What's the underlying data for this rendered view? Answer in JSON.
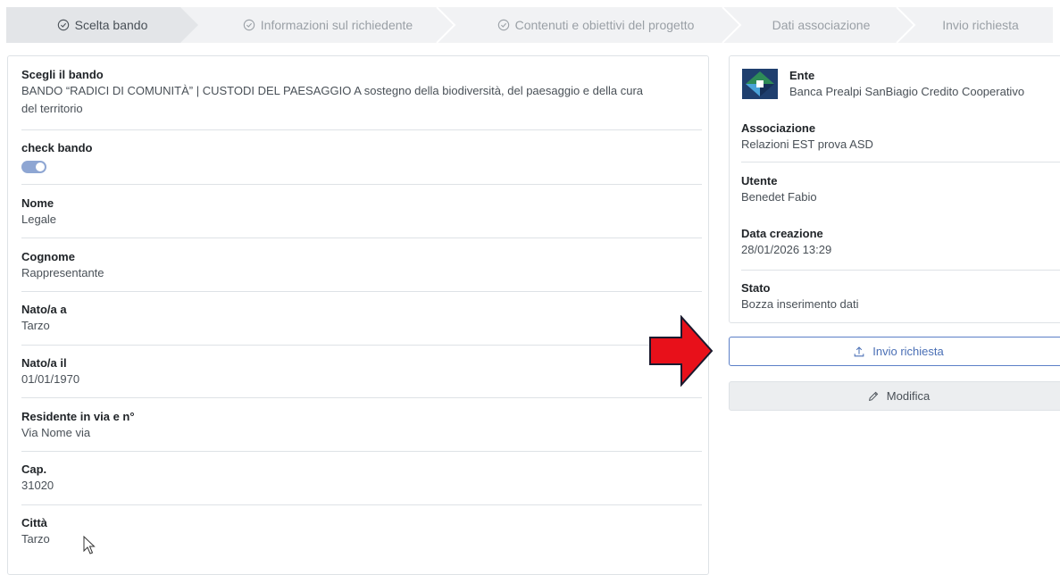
{
  "stepper": {
    "steps": [
      {
        "label": "Scelta bando",
        "check": true
      },
      {
        "label": "Informazioni sul richiedente",
        "check": true
      },
      {
        "label": "Contenuti e obiettivi del progetto",
        "check": true
      },
      {
        "label": "Dati associazione",
        "check": false
      },
      {
        "label": "Invio richiesta",
        "check": false
      }
    ]
  },
  "form": {
    "bando": {
      "label": "Scegli il bando",
      "value_line1": "BANDO “RADICI DI COMUNITÀ” | CUSTODI DEL PAESAGGIO A sostegno della biodiversità, del paesaggio e della cura",
      "value_line2": "del territorio"
    },
    "check_bando": {
      "label": "check bando",
      "checked": true
    },
    "nome": {
      "label": "Nome",
      "value": "Legale"
    },
    "cognome": {
      "label": "Cognome",
      "value": "Rappresentante"
    },
    "nato_a": {
      "label": "Nato/a a",
      "value": "Tarzo"
    },
    "nato_il": {
      "label": "Nato/a il",
      "value": "01/01/1970"
    },
    "residente": {
      "label": "Residente in via e n°",
      "value": "Via Nome via"
    },
    "cap": {
      "label": "Cap.",
      "value": "31020"
    },
    "citta": {
      "label": "Città",
      "value": "Tarzo"
    }
  },
  "summary": {
    "ente": {
      "label": "Ente",
      "value": "Banca Prealpi SanBiagio Credito Cooperativo"
    },
    "associazione": {
      "label": "Associazione",
      "value": "Relazioni EST prova ASD"
    },
    "utente": {
      "label": "Utente",
      "value": "Benedet Fabio"
    },
    "data_creazione": {
      "label": "Data creazione",
      "value": "28/01/2026 13:29"
    },
    "stato": {
      "label": "Stato",
      "value": "Bozza inserimento dati"
    }
  },
  "actions": {
    "send_label": "Invio richiesta",
    "edit_label": "Modifica"
  },
  "colors": {
    "accent": "#4a6fb5",
    "toggle": "#8ea6d3",
    "arrow_fill": "#e8101a",
    "logo_green": "#2e8b57",
    "logo_navy": "#1f3f6e"
  },
  "icons": {
    "step_done": "circle-check-icon",
    "send": "upload-icon",
    "edit": "pencil-icon"
  }
}
